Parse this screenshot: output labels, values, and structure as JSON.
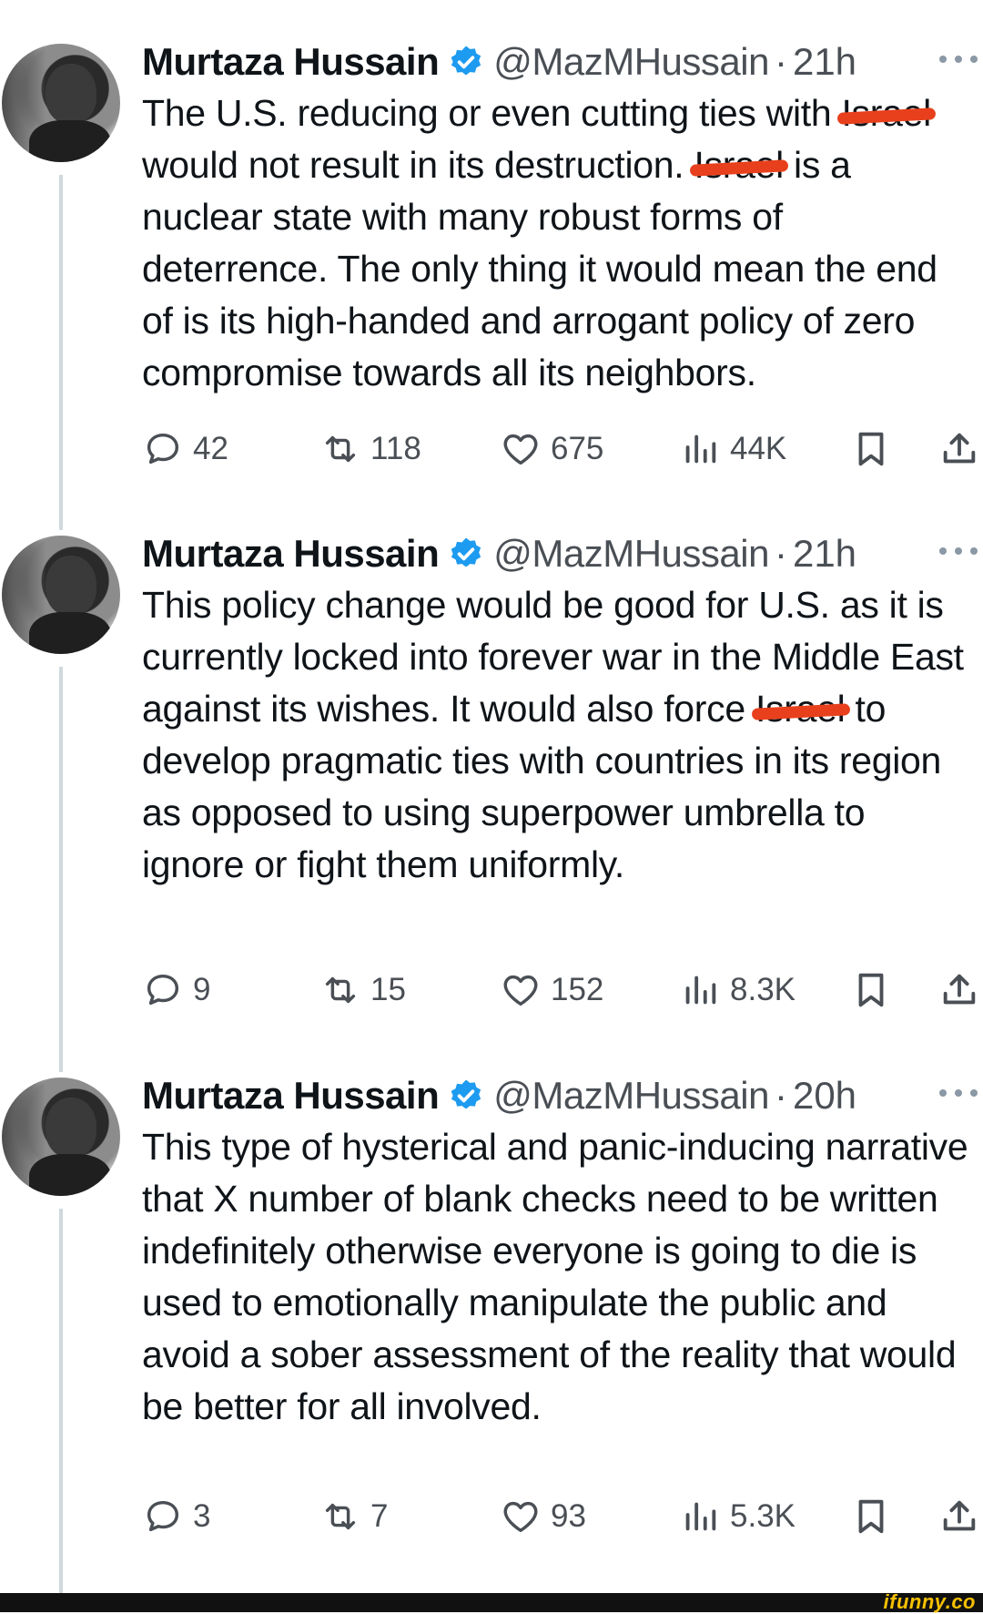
{
  "tweets": [
    {
      "name": "Murtaza Hussain",
      "handle": "@MazMHussain",
      "separator": "·",
      "time": "21h",
      "text_parts": [
        "The U.S. reducing or even cutting ties with ",
        "Israel",
        " would not result in its destruction. ",
        "Israel",
        " is a nuclear state with many robust forms of deterrence. The only thing it would mean the end of is its high-handed and arrogant policy of zero compromise towards all its neighbors."
      ],
      "replies": "42",
      "reposts": "118",
      "likes": "675",
      "views": "44K"
    },
    {
      "name": "Murtaza Hussain",
      "handle": "@MazMHussain",
      "separator": "·",
      "time": "21h",
      "text_parts": [
        "This policy change would be good for U.S. as it is currently locked into forever war in the Middle East against its wishes. It would also force ",
        "Israel",
        " to develop pragmatic ties with countries in its region as opposed to using superpower umbrella to ignore or fight them uniformly."
      ],
      "replies": "9",
      "reposts": "15",
      "likes": "152",
      "views": "8.3K"
    },
    {
      "name": "Murtaza Hussain",
      "handle": "@MazMHussain",
      "separator": "·",
      "time": "20h",
      "text": "This type of hysterical and panic-inducing narrative that X number of blank checks need to be written indefinitely otherwise everyone is going to die is used to emotionally manipulate the public and avoid a sober assessment of the reality that would be better for all involved.",
      "replies": "3",
      "reposts": "7",
      "likes": "93",
      "views": "5.3K"
    }
  ],
  "icons": {
    "verified": "verified-badge-icon",
    "reply": "reply-icon",
    "repost": "repost-icon",
    "like": "heart-icon",
    "views": "views-icon",
    "bookmark": "bookmark-icon",
    "share": "share-icon",
    "more": "more-icon"
  },
  "colors": {
    "verified": "#1d9bf0",
    "redaction": "#e8401c",
    "muted": "#4a4f55",
    "thread_line": "#cfd9de"
  },
  "watermark": "ifunny.co"
}
